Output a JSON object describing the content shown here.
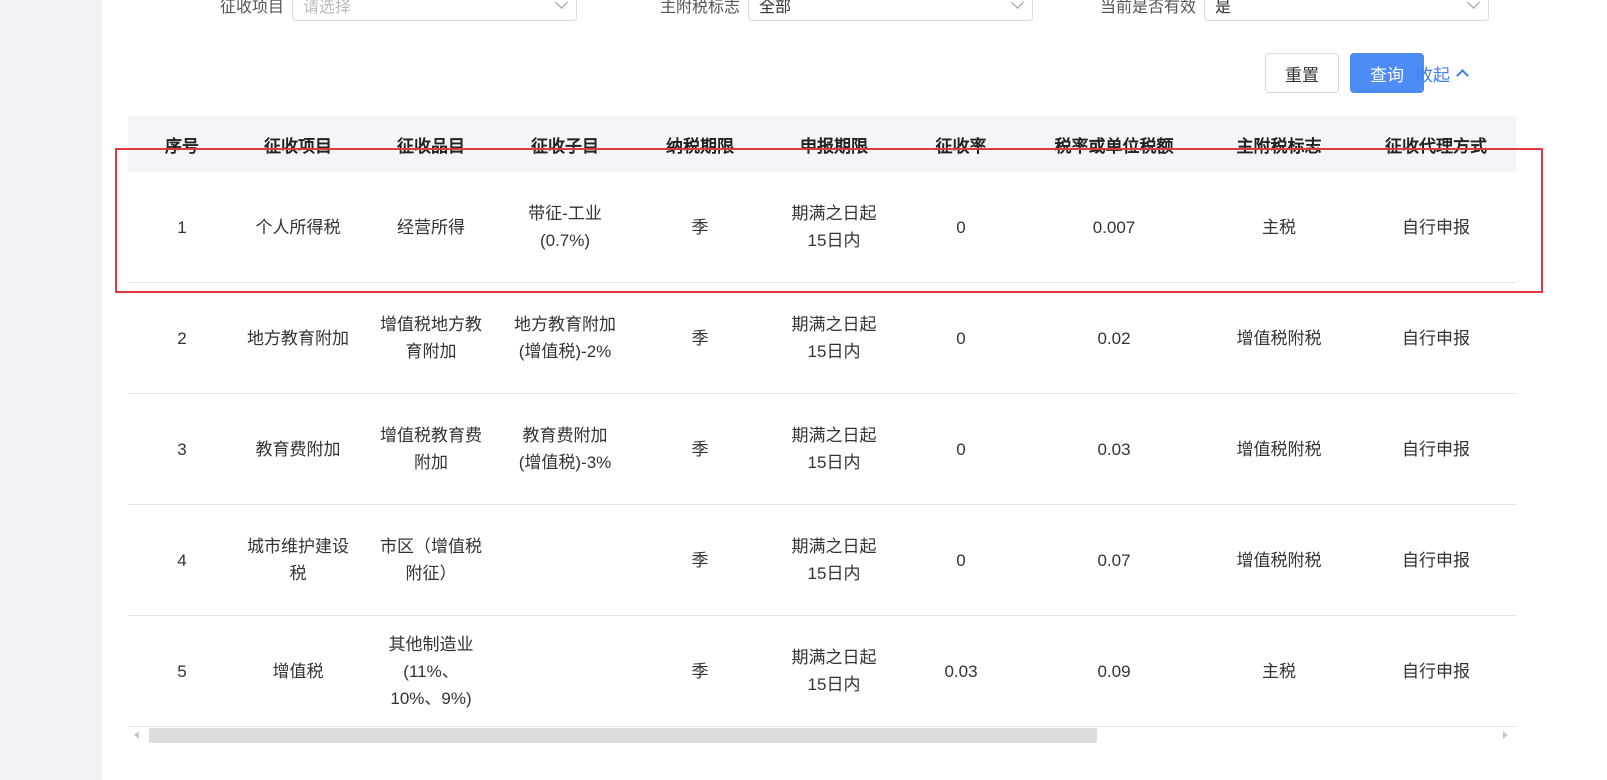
{
  "filters": {
    "item": {
      "label": "征收项目",
      "placeholder": "请选择"
    },
    "main_sub_flag": {
      "label": "主附税标志",
      "value": "全部"
    },
    "is_valid": {
      "label": "当前是否有效",
      "value": "是"
    }
  },
  "buttons": {
    "reset": "重置",
    "query": "查询",
    "collapse": "收起"
  },
  "colors": {
    "primary": "#4d8cf4",
    "link": "#3f7ef0",
    "highlight": "#e0393e"
  },
  "table": {
    "columns": [
      "序号",
      "征收项目",
      "征收品目",
      "征收子目",
      "纳税期限",
      "申报期限",
      "征收率",
      "税率或单位税额",
      "主附税标志",
      "征收代理方式"
    ],
    "rows": [
      [
        "1",
        "个人所得税",
        "经营所得",
        "带征-工业\n(0.7%)",
        "季",
        "期满之日起\n15日内",
        "0",
        "0.007",
        "主税",
        "自行申报"
      ],
      [
        "2",
        "地方教育附加",
        "增值税地方教\n育附加",
        "地方教育附加\n(增值税)-2%",
        "季",
        "期满之日起\n15日内",
        "0",
        "0.02",
        "增值税附税",
        "自行申报"
      ],
      [
        "3",
        "教育费附加",
        "增值税教育费\n附加",
        "教育费附加\n(增值税)-3%",
        "季",
        "期满之日起\n15日内",
        "0",
        "0.03",
        "增值税附税",
        "自行申报"
      ],
      [
        "4",
        "城市维护建设\n税",
        "市区（增值税\n附征）",
        "",
        "季",
        "期满之日起\n15日内",
        "0",
        "0.07",
        "增值税附税",
        "自行申报"
      ],
      [
        "5",
        "增值税",
        "其他制造业\n(11%、\n10%、9%)",
        "",
        "季",
        "期满之日起\n15日内",
        "0.03",
        "0.09",
        "主税",
        "自行申报"
      ]
    ]
  }
}
